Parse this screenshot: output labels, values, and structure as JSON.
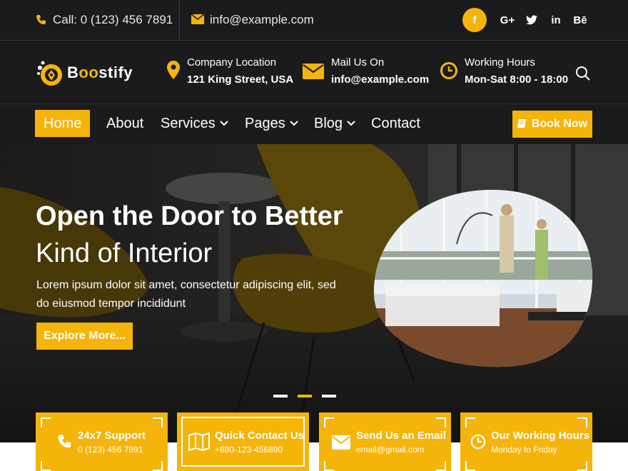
{
  "topbar": {
    "call": "Call: 0 (123) 456 7891",
    "email": "info@example.com",
    "social": [
      {
        "name": "facebook",
        "glyph": "f"
      },
      {
        "name": "google-plus",
        "glyph": "G+"
      },
      {
        "name": "twitter",
        "glyph": "t"
      },
      {
        "name": "linkedin",
        "glyph": "in"
      },
      {
        "name": "behance",
        "glyph": "Bē"
      }
    ]
  },
  "header": {
    "logo": {
      "prefix": "B",
      "accent": "oo",
      "suffix": "stify"
    },
    "location": {
      "title": "Company Location",
      "value": "121 King Street, USA"
    },
    "mail": {
      "title": "Mail Us On",
      "value": "info@example.com"
    },
    "hours": {
      "title": "Working Hours",
      "value": "Mon-Sat 8:00 - 18:00"
    }
  },
  "nav": {
    "items": [
      {
        "label": "Home",
        "active": true
      },
      {
        "label": "About"
      },
      {
        "label": "Services",
        "dropdown": true
      },
      {
        "label": "Pages",
        "dropdown": true
      },
      {
        "label": "Blog",
        "dropdown": true
      },
      {
        "label": "Contact"
      }
    ],
    "book_label": "Book Now"
  },
  "hero": {
    "title_line1": "Open the Door to Better",
    "title_line2": "Kind of Interior",
    "text": "Lorem ipsum dolor sit amet, consectetur adipiscing elit, sed do eiusmod tempor incididunt",
    "button": "Explore More...",
    "slides": 3,
    "active_slide": 2
  },
  "features": [
    {
      "title": "24x7 Support",
      "sub": "0 (123) 456 7891",
      "icon": "phone-icon"
    },
    {
      "title": "Quick Contact Us",
      "sub": "+880-123-456890",
      "icon": "map-icon"
    },
    {
      "title": "Send Us an Email",
      "sub": "email@gmail.com",
      "icon": "envelope-icon"
    },
    {
      "title": "Our Working Hours",
      "sub": "Monday to Friday",
      "icon": "clock-icon"
    }
  ],
  "colors": {
    "accent": "#f5b40a",
    "dark": "#1b1b1d"
  }
}
